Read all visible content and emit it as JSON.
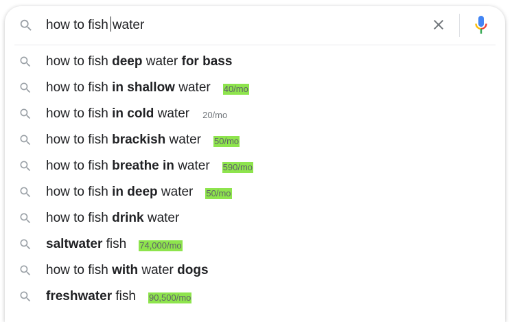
{
  "search": {
    "query_before_caret": "how to fish",
    "query_after_caret": "water",
    "clear_icon": "close-icon",
    "mic_icon": "microphone-icon"
  },
  "colors": {
    "volume_highlight": "#8ee44d",
    "mic_blue": "#4285f4",
    "mic_red": "#ea4335",
    "mic_yellow": "#fbbc04",
    "mic_green": "#34a853"
  },
  "suggestions": [
    {
      "parts": [
        {
          "t": "how to fish ",
          "b": false
        },
        {
          "t": "deep",
          "b": true
        },
        {
          "t": " water ",
          "b": false
        },
        {
          "t": "for bass",
          "b": true
        }
      ],
      "volume": "",
      "highlight": false
    },
    {
      "parts": [
        {
          "t": "how to fish ",
          "b": false
        },
        {
          "t": "in shallow",
          "b": true
        },
        {
          "t": " water",
          "b": false
        }
      ],
      "volume": "40/mo",
      "highlight": true
    },
    {
      "parts": [
        {
          "t": "how to fish ",
          "b": false
        },
        {
          "t": "in cold",
          "b": true
        },
        {
          "t": " water",
          "b": false
        }
      ],
      "volume": "20/mo",
      "highlight": false
    },
    {
      "parts": [
        {
          "t": "how to fish ",
          "b": false
        },
        {
          "t": "brackish",
          "b": true
        },
        {
          "t": " water",
          "b": false
        }
      ],
      "volume": "50/mo",
      "highlight": true
    },
    {
      "parts": [
        {
          "t": "how to fish ",
          "b": false
        },
        {
          "t": "breathe in",
          "b": true
        },
        {
          "t": " water",
          "b": false
        }
      ],
      "volume": "590/mo",
      "highlight": true
    },
    {
      "parts": [
        {
          "t": "how to fish ",
          "b": false
        },
        {
          "t": "in deep",
          "b": true
        },
        {
          "t": " water",
          "b": false
        }
      ],
      "volume": "50/mo",
      "highlight": true
    },
    {
      "parts": [
        {
          "t": "how to fish ",
          "b": false
        },
        {
          "t": "drink",
          "b": true
        },
        {
          "t": " water",
          "b": false
        }
      ],
      "volume": "",
      "highlight": false
    },
    {
      "parts": [
        {
          "t": "saltwater",
          "b": true
        },
        {
          "t": " fish",
          "b": false
        }
      ],
      "volume": "74,000/mo",
      "highlight": true
    },
    {
      "parts": [
        {
          "t": "how to fish ",
          "b": false
        },
        {
          "t": "with",
          "b": true
        },
        {
          "t": " water ",
          "b": false
        },
        {
          "t": "dogs",
          "b": true
        }
      ],
      "volume": "",
      "highlight": false
    },
    {
      "parts": [
        {
          "t": "freshwater",
          "b": true
        },
        {
          "t": " fish",
          "b": false
        }
      ],
      "volume": "90,500/mo",
      "highlight": true
    }
  ]
}
